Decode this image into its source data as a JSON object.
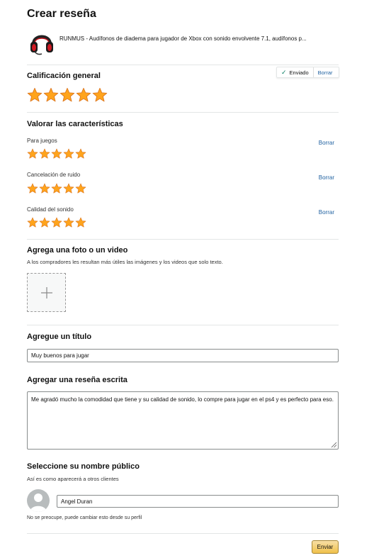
{
  "page": {
    "title": "Crear reseña"
  },
  "product": {
    "title": "RUNMUS - Audífonos de diadema para jugador de Xbox con sonido envolvente 7.1, audífonos p..."
  },
  "overall": {
    "heading": "Calificación general",
    "rating": 5,
    "max": 5,
    "status_label": "Enviado",
    "clear_label": "Borrar"
  },
  "features": {
    "heading": "Valorar las características",
    "items": [
      {
        "label": "Para juegos",
        "rating": 5,
        "clear_label": "Borrar"
      },
      {
        "label": "Cancelación de ruido",
        "rating": 5,
        "clear_label": "Borrar"
      },
      {
        "label": "Calidad del sonido",
        "rating": 5,
        "clear_label": "Borrar"
      }
    ]
  },
  "media": {
    "heading": "Agrega una foto o un video",
    "subtitle": "A los compradores les resultan más útiles las imágenes y los videos que solo texto.",
    "add_icon": "plus-icon"
  },
  "title_section": {
    "heading": "Agregue un título",
    "value": "Muy buenos para jugar"
  },
  "review_section": {
    "heading": "Agregar una reseña escrita",
    "value": "Me agradó mucho la comodidad que tiene y su calidad de sonido, lo compre para jugar en el ps4 y es perfecto para eso."
  },
  "public_name": {
    "heading": "Seleccione su nombre público",
    "subtitle": "Así es como aparecerá a otros clientes",
    "value": "Angel Duran",
    "note": "No se preocupe, puede cambiar esto desde su perfil"
  },
  "actions": {
    "submit_label": "Enviar"
  },
  "colors": {
    "star": "#ffa41c",
    "link": "#2162a1",
    "button": "#f0c14b",
    "divider": "#e3e6e6"
  }
}
